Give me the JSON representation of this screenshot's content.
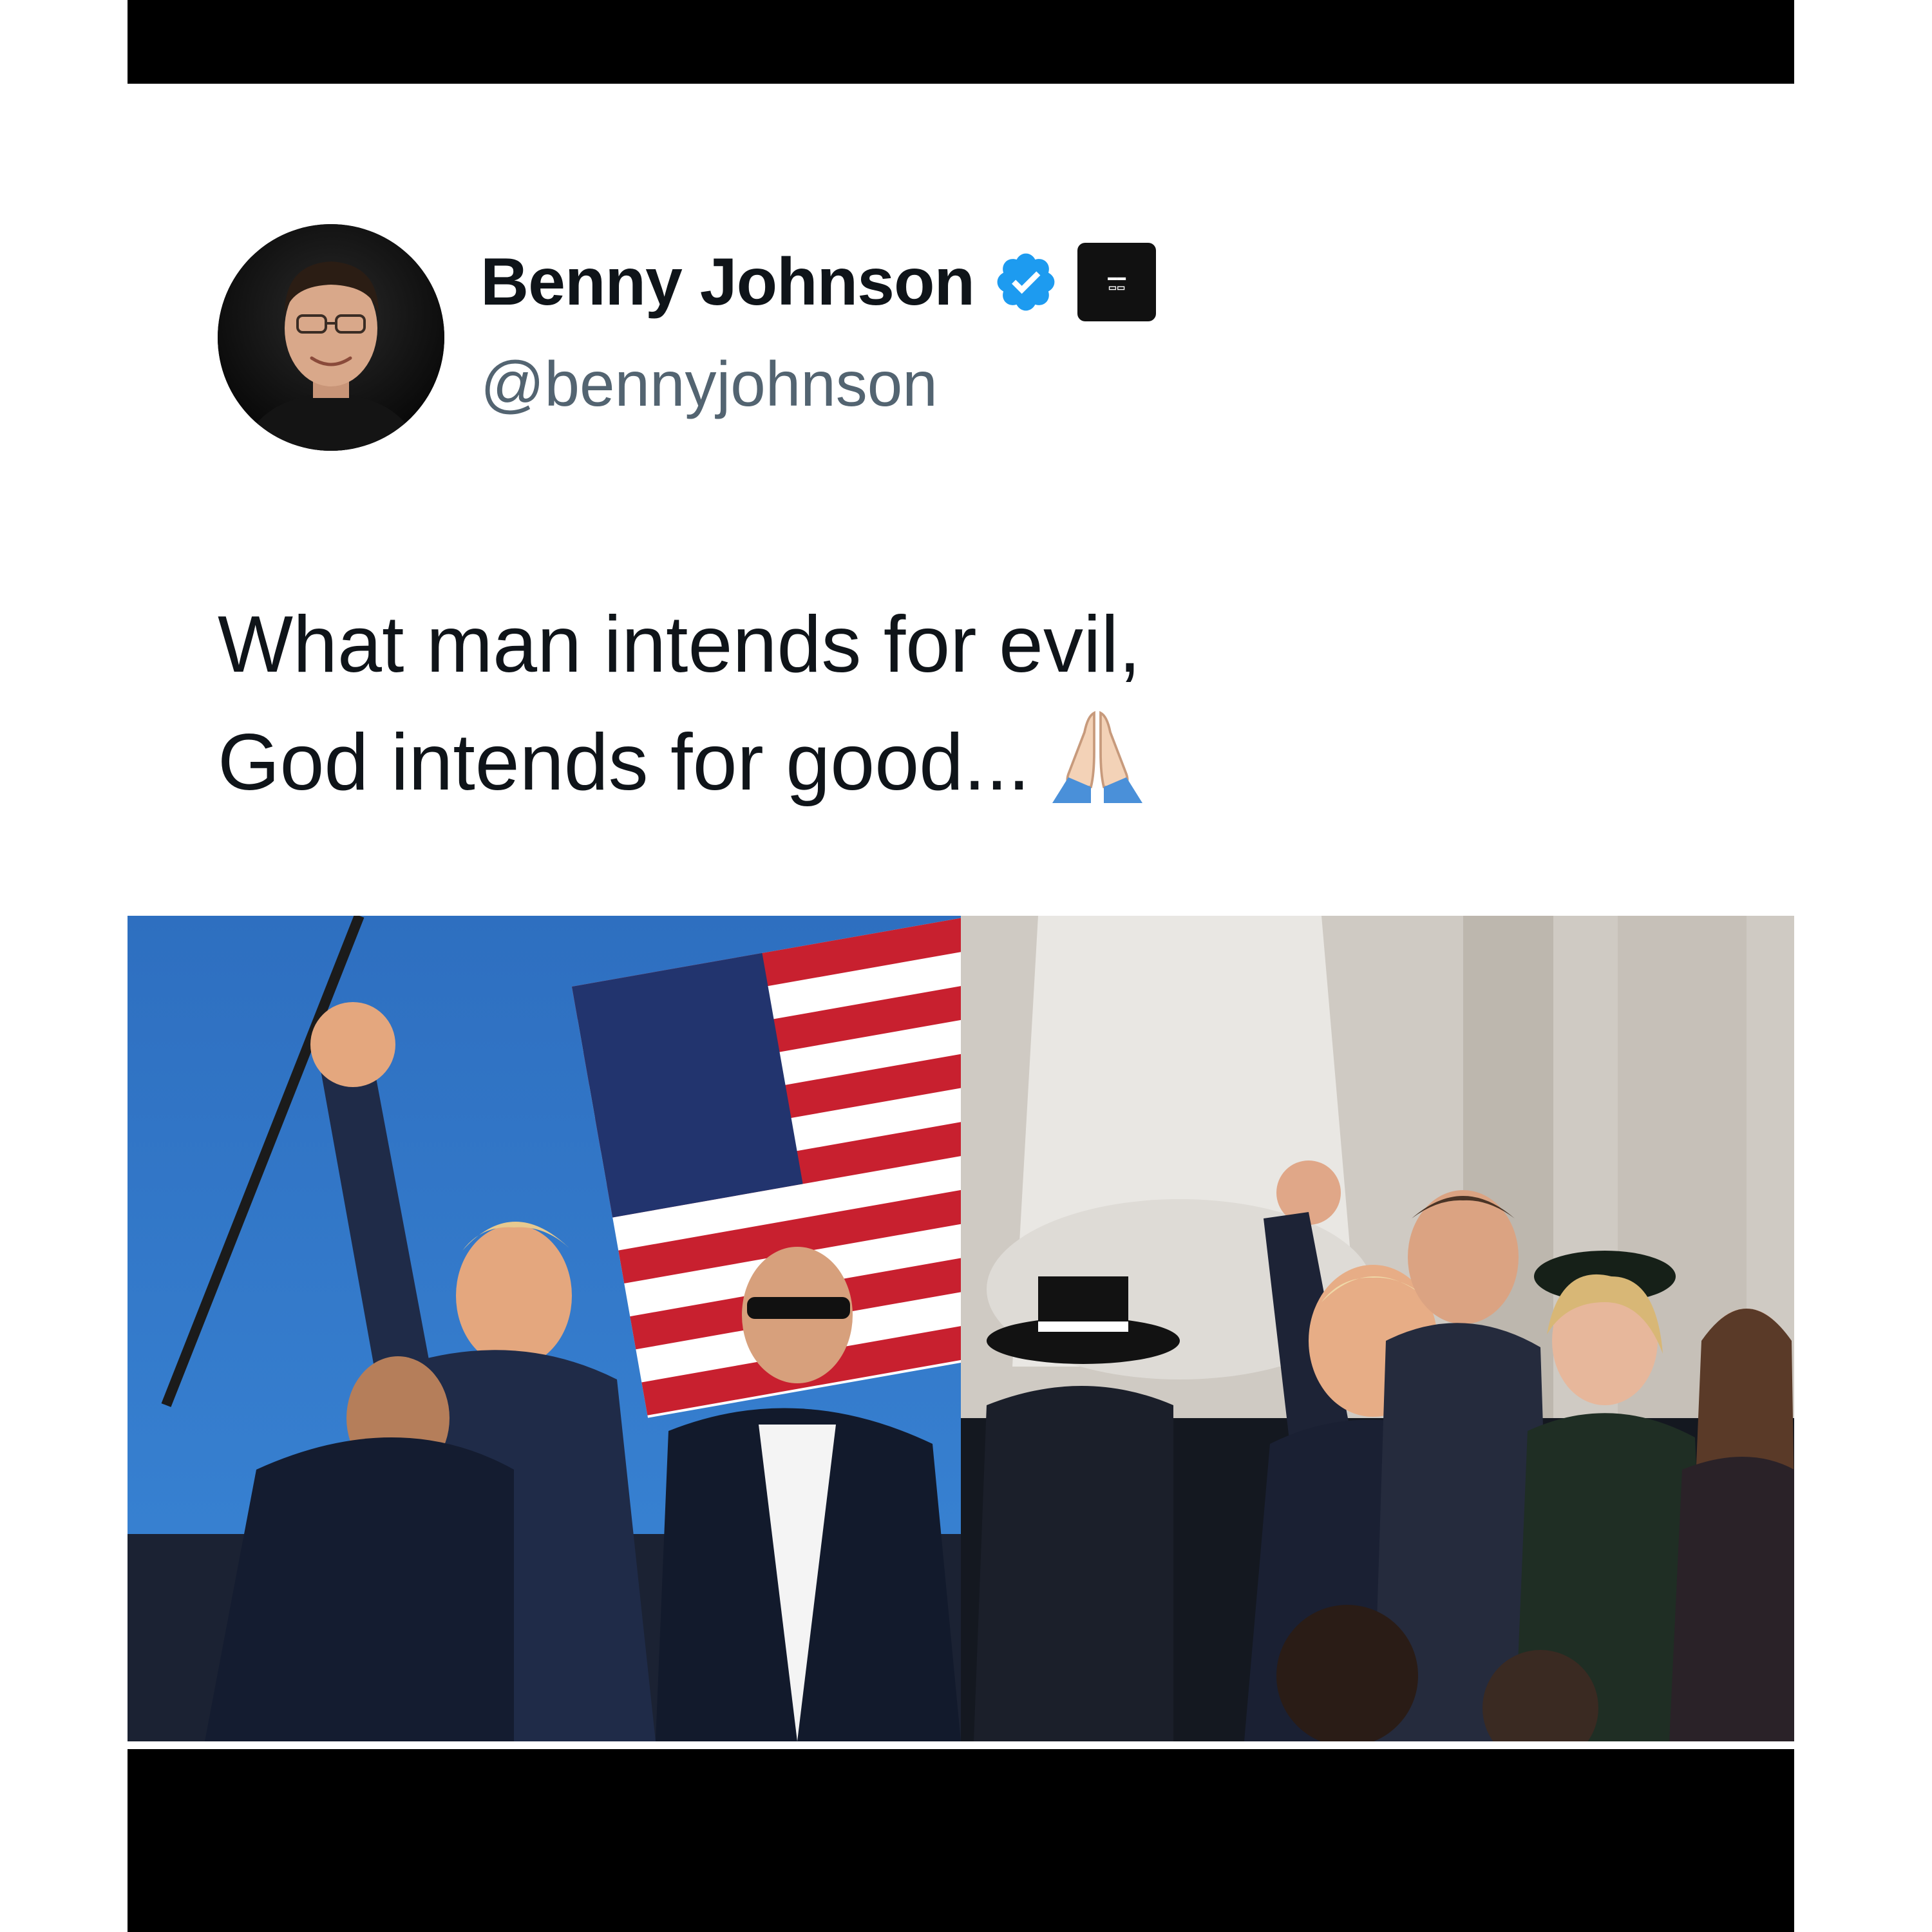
{
  "tweet": {
    "author": {
      "display_name": "Benny Johnson",
      "handle": "@bennyjohnson",
      "verified": true
    },
    "text_lines": [
      "What man intends for evil,",
      "God intends for good..."
    ],
    "emoji": "folded-hands"
  },
  "media": {
    "panels": [
      {
        "name": "photo-left",
        "description_icon": "photo"
      },
      {
        "name": "photo-right",
        "description_icon": "photo"
      }
    ]
  },
  "colors": {
    "text_primary": "#0f1419",
    "text_secondary": "#536471",
    "verified_blue": "#1d9bf0",
    "frame_bars": "#000000"
  }
}
